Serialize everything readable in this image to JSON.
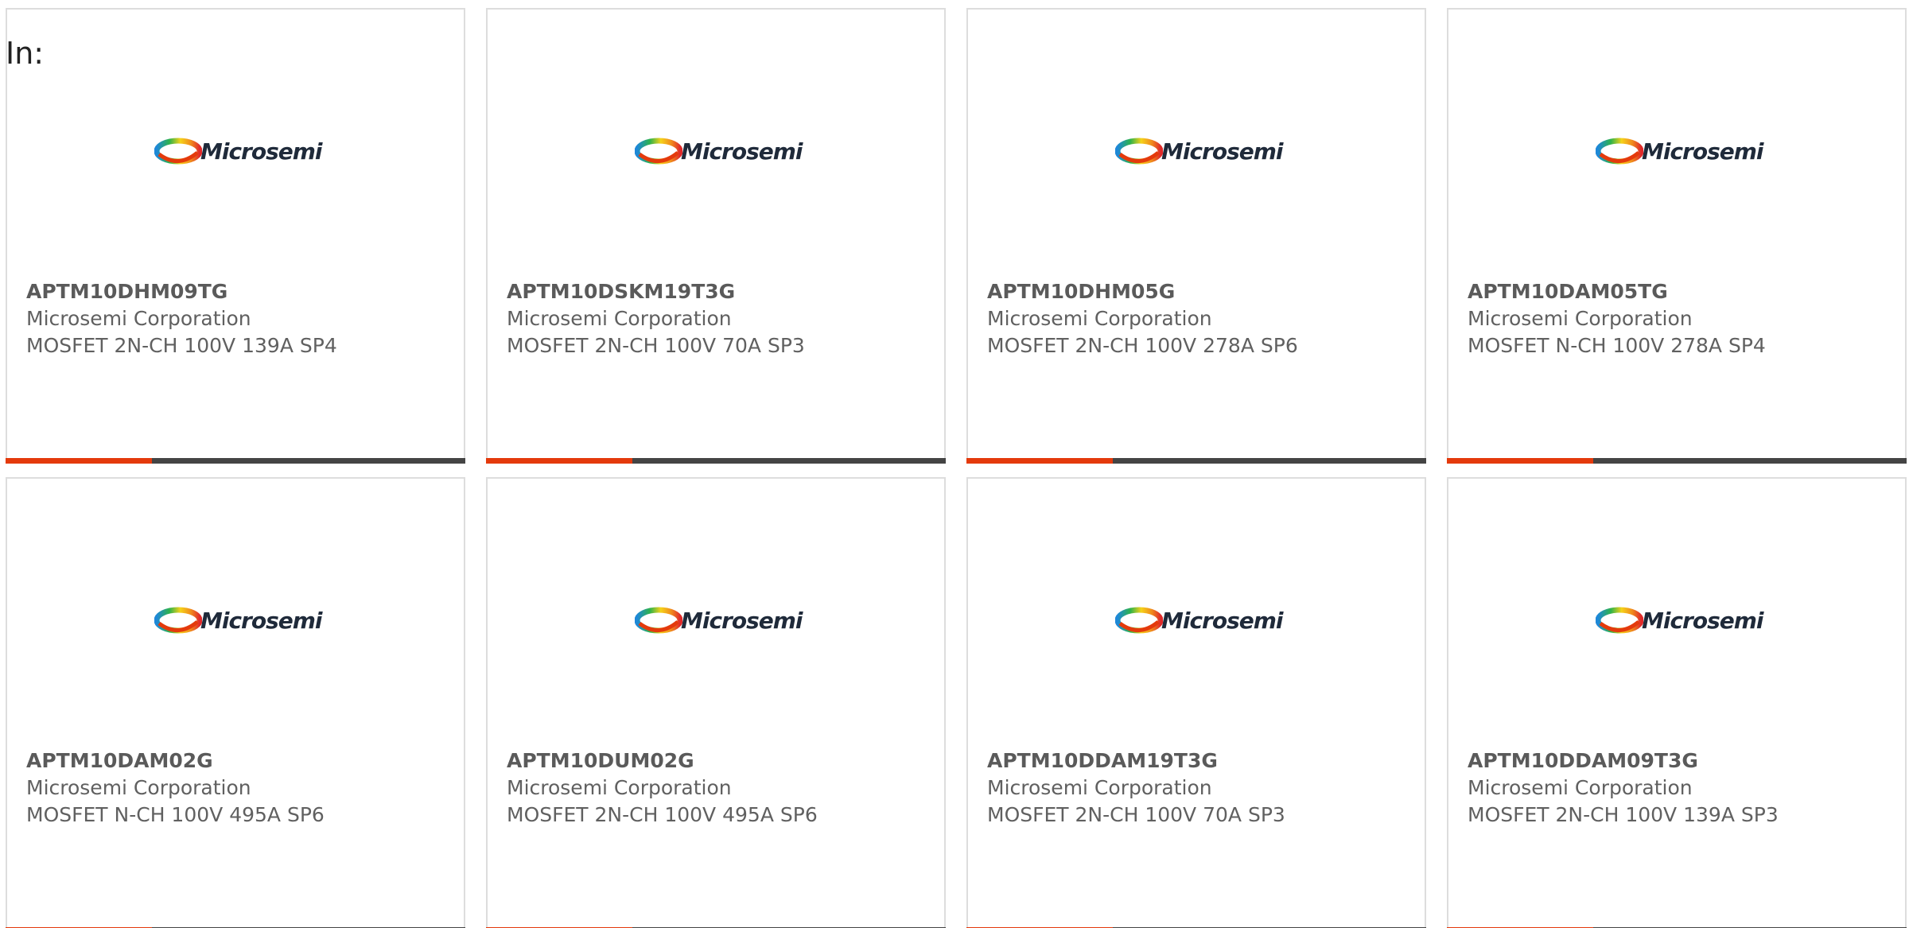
{
  "intro_label": "In:",
  "colors": {
    "accent": "#e43a0c",
    "bar": "#444444",
    "card_border": "#dddddd",
    "text_muted": "#606060"
  },
  "logo": {
    "text": "Microsemi",
    "icon": "microsemi-logo-icon"
  },
  "cards": [
    {
      "part_number": "APTM10DHM09TG",
      "manufacturer": "Microsemi Corporation",
      "description": "MOSFET 2N-CH 100V 139A SP4"
    },
    {
      "part_number": "APTM10DSKM19T3G",
      "manufacturer": "Microsemi Corporation",
      "description": "MOSFET 2N-CH 100V 70A SP3"
    },
    {
      "part_number": "APTM10DHM05G",
      "manufacturer": "Microsemi Corporation",
      "description": "MOSFET 2N-CH 100V 278A SP6"
    },
    {
      "part_number": "APTM10DAM05TG",
      "manufacturer": "Microsemi Corporation",
      "description": "MOSFET N-CH 100V 278A SP4"
    },
    {
      "part_number": "APTM10DAM02G",
      "manufacturer": "Microsemi Corporation",
      "description": "MOSFET N-CH 100V 495A SP6"
    },
    {
      "part_number": "APTM10DUM02G",
      "manufacturer": "Microsemi Corporation",
      "description": "MOSFET 2N-CH 100V 495A SP6"
    },
    {
      "part_number": "APTM10DDAM19T3G",
      "manufacturer": "Microsemi Corporation",
      "description": "MOSFET 2N-CH 100V 70A SP3"
    },
    {
      "part_number": "APTM10DDAM09T3G",
      "manufacturer": "Microsemi Corporation",
      "description": "MOSFET 2N-CH 100V 139A SP3"
    }
  ]
}
